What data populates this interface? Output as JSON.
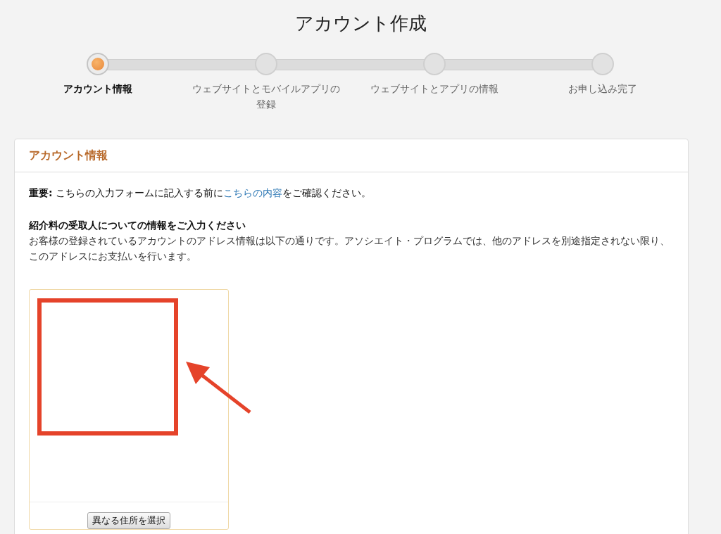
{
  "page_title": "アカウント作成",
  "steps": [
    {
      "label": "アカウント情報",
      "selected": true
    },
    {
      "label": "ウェブサイトとモバイルアプリの登録",
      "selected": false
    },
    {
      "label": "ウェブサイトとアプリの情報",
      "selected": false
    },
    {
      "label": "お申し込み完了",
      "selected": false
    }
  ],
  "section": {
    "title": "アカウント情報",
    "notice": {
      "before": "**重要:** こちらの入力フォームに記入する前に",
      "link": "こちらの内容",
      "after": "をご確認ください。"
    },
    "heading": "紹介料の受取人についての情報をご入力ください",
    "description": "お客様の登録されているアカウントのアドレス情報は以下の通りです。アソシエイト・プログラムでは、他のアドレスを別途指定されない限り、このアドレスにお支払いを行います。",
    "address_card": {
      "button": "異なる住所を選択",
      "annotation": {
        "kind": "box-arrow",
        "color": "#e5432a"
      }
    }
  }
}
